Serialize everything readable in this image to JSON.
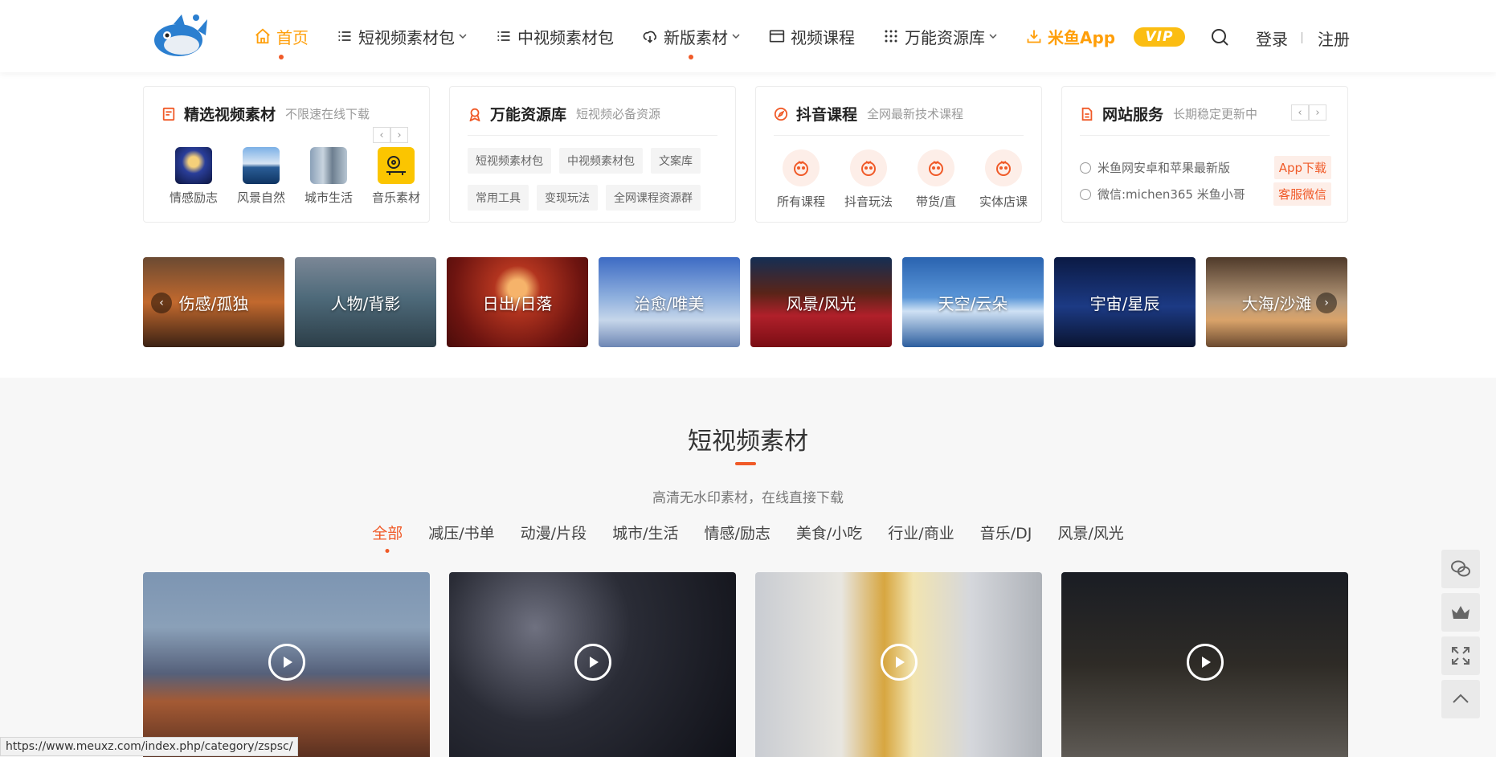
{
  "nav": {
    "home": "首页",
    "short_pack": "短视频素材包",
    "mid_pack": "中视频素材包",
    "new_material": "新版素材",
    "video_course": "视频课程",
    "resources": "万能资源库",
    "app": "米鱼App",
    "vip": "VIP",
    "login": "登录",
    "register": "注册"
  },
  "cards": {
    "featured": {
      "title": "精选视频素材",
      "sub": "不限速在线下载",
      "items": [
        "情感励志",
        "风景自然",
        "城市生活",
        "音乐素材"
      ],
      "prev": "‹",
      "next": "›"
    },
    "library": {
      "title": "万能资源库",
      "sub": "短视频必备资源",
      "tags": [
        "短视频素材包",
        "中视频素材包",
        "文案库",
        "常用工具",
        "变现玩法",
        "全网课程资源群"
      ]
    },
    "douyin": {
      "title": "抖音课程",
      "sub": "全网最新技术课程",
      "items": [
        "所有课程",
        "抖音玩法",
        "带货/直",
        "实体店课"
      ]
    },
    "service": {
      "title": "网站服务",
      "sub": "长期稳定更新中",
      "lines": [
        {
          "text": "米鱼网安卓和苹果最新版",
          "badge": "App下载"
        },
        {
          "text": "微信:michen365 米鱼小哥",
          "badge": "客服微信"
        }
      ],
      "prev": "‹",
      "next": "›"
    }
  },
  "banners": [
    "伤感/孤独",
    "人物/背影",
    "日出/日落",
    "治愈/唯美",
    "风景/风光",
    "天空/云朵",
    "宇宙/星辰",
    "大海/沙滩"
  ],
  "banner_nav": {
    "prev": "‹",
    "next": "›"
  },
  "section": {
    "title": "短视频素材",
    "subtitle": "高清无水印素材，在线直接下载",
    "filters": [
      "全部",
      "减压/书单",
      "动漫/片段",
      "城市/生活",
      "情感/励志",
      "美食/小吃",
      "行业/商业",
      "音乐/DJ",
      "风景/风光"
    ]
  },
  "status_url": "https://www.meuxz.com/index.php/category/zspsc/",
  "colors": {
    "accent": "#f05a28",
    "orange": "#ff9f0a",
    "vip": "#fbbd12"
  },
  "icons": [
    "home-icon",
    "list-icon",
    "cloud-download-icon",
    "video-icon",
    "grid-icon",
    "download-icon",
    "search-icon",
    "wechat-icon",
    "crown-icon",
    "fullscreen-icon",
    "arrow-up-icon",
    "play-icon"
  ]
}
